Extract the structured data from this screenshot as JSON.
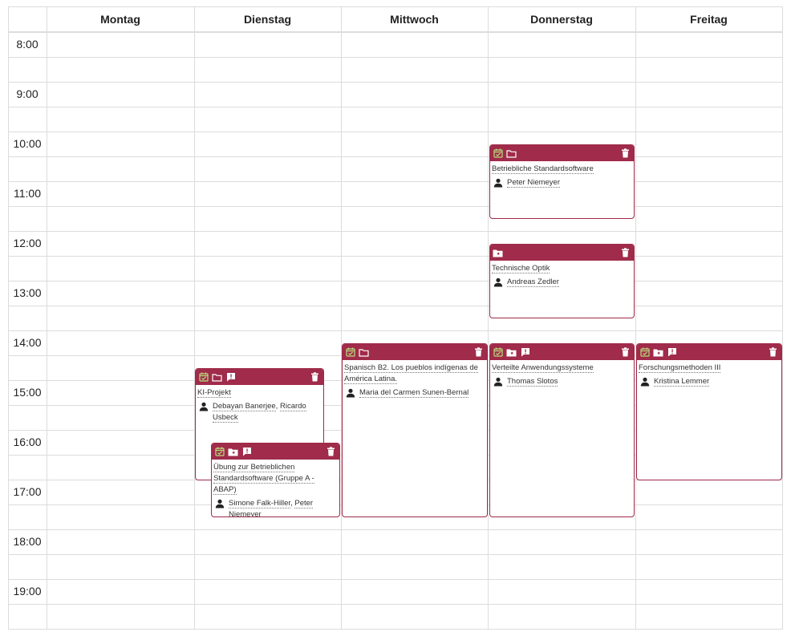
{
  "calendar": {
    "days": [
      "Montag",
      "Dienstag",
      "Mittwoch",
      "Donnerstag",
      "Freitag"
    ],
    "hours": [
      "8:00",
      "9:00",
      "10:00",
      "11:00",
      "12:00",
      "13:00",
      "14:00",
      "15:00",
      "16:00",
      "17:00",
      "18:00",
      "19:00"
    ]
  },
  "colors": {
    "event_header": "#a02b4a",
    "event_border": "#9f2a48",
    "check_icon": "#b7e07a",
    "grid": "#dcdcdc"
  },
  "events": [
    {
      "id": "betriebliche",
      "title": "Betriebliche Standardsoftware",
      "people": [
        "Peter Niemeyer"
      ],
      "icons": [
        "calendar-check-icon",
        "folder-icon"
      ]
    },
    {
      "id": "optik",
      "title": "Technische Optik",
      "people": [
        "Andreas Zedler"
      ],
      "icons": [
        "folder-star-icon"
      ]
    },
    {
      "id": "ki",
      "title": "KI-Projekt",
      "people": [
        "Debayan Banerjee",
        "Ricardo Usbeck"
      ],
      "icons": [
        "calendar-check-icon",
        "folder-icon",
        "comment-alert-icon"
      ]
    },
    {
      "id": "uebung",
      "title": "Übung zur Betrieblichen Standardsoftware (Gruppe A - ABAP)",
      "people": [
        "Simone Falk-Hiller",
        "Peter Niemeyer"
      ],
      "icons": [
        "calendar-check-icon",
        "folder-star-icon",
        "comment-alert-icon"
      ]
    },
    {
      "id": "spanisch",
      "title": "Spanisch B2. Los pueblos indígenas de América Latina.",
      "people": [
        "Maria del Carmen Sunen-Bernal"
      ],
      "icons": [
        "calendar-check-icon",
        "folder-icon"
      ]
    },
    {
      "id": "verteilte",
      "title": "Verteilte Anwendungssysteme",
      "people": [
        "Thomas Slotos"
      ],
      "icons": [
        "calendar-check-icon",
        "folder-star-icon",
        "comment-alert-icon"
      ]
    },
    {
      "id": "forschung",
      "title": "Forschungsmethoden III",
      "people": [
        "Kristina Lemmer"
      ],
      "icons": [
        "calendar-check-icon",
        "folder-star-icon",
        "comment-alert-icon"
      ]
    }
  ]
}
